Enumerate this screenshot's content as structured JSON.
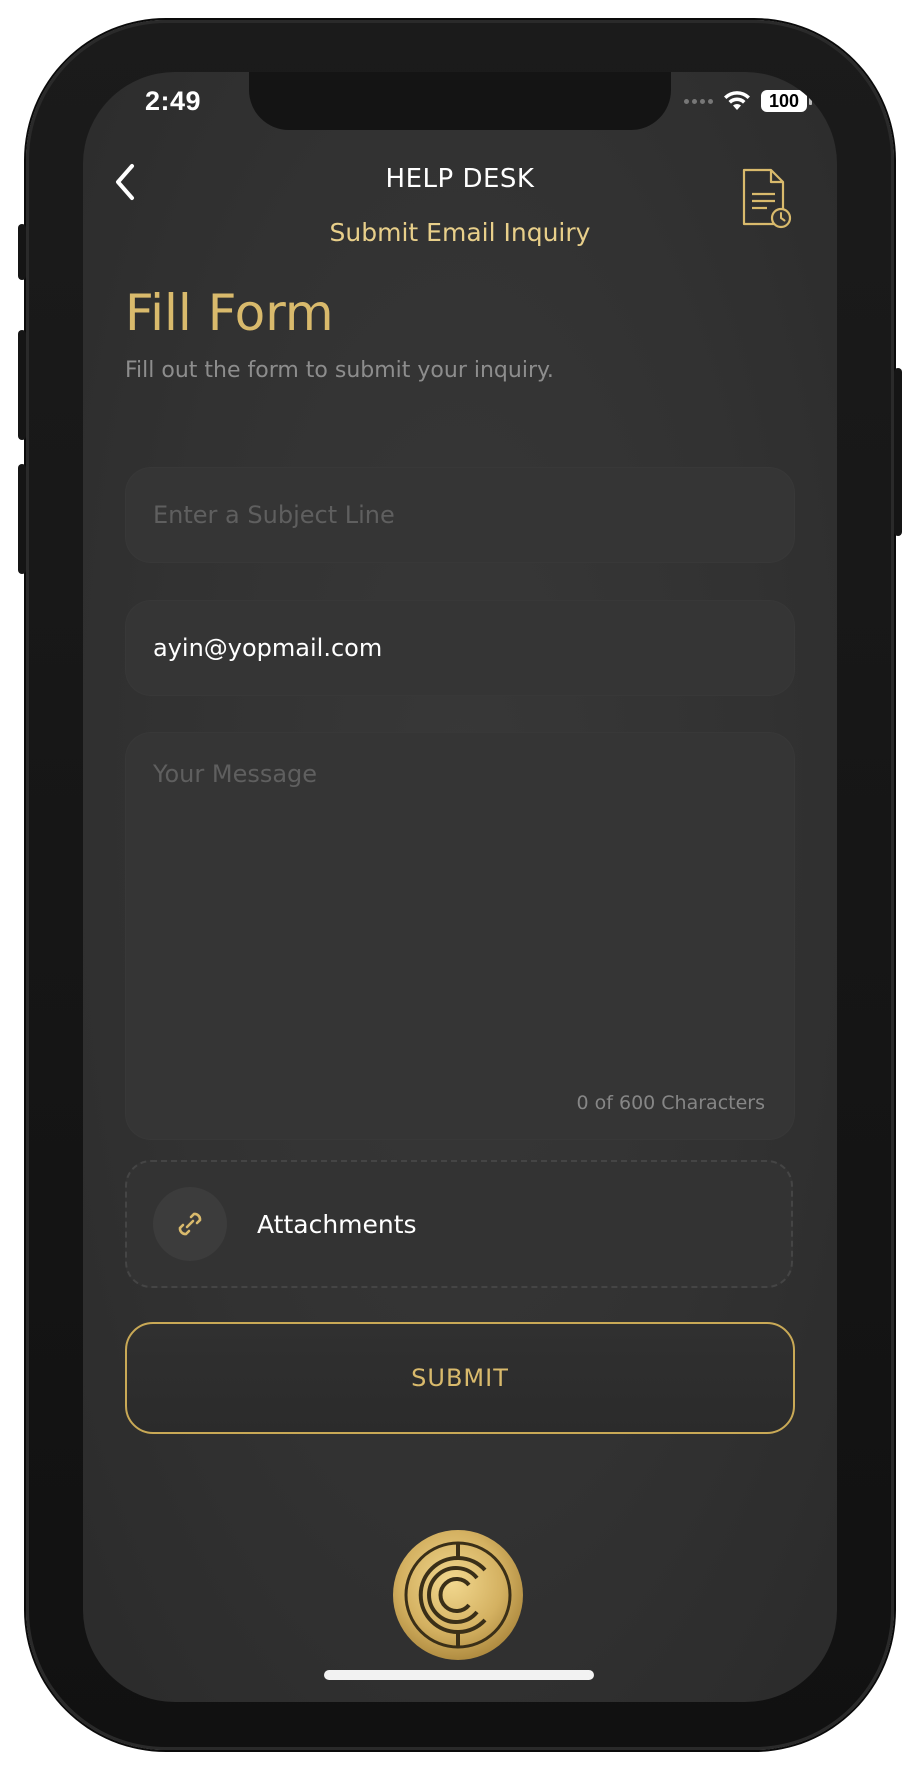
{
  "status_bar": {
    "time": "2:49",
    "battery": "100"
  },
  "header": {
    "title": "HELP DESK",
    "subtitle": "Submit Email Inquiry"
  },
  "form": {
    "title": "Fill Form",
    "description": "Fill out the form to submit your inquiry.",
    "subject_placeholder": "Enter a Subject Line",
    "subject_value": "",
    "email_value": "ayin@yopmail.com",
    "message_placeholder": "Your Message",
    "message_value": "",
    "char_count": "0 of 600 Characters",
    "attachments_label": "Attachments",
    "submit_label": "SUBMIT"
  },
  "icons": {
    "back": "chevron-left-icon",
    "history": "document-clock-icon",
    "attach": "link-icon",
    "logo": "brand-logo"
  },
  "colors": {
    "accent_gold": "#d9ba6c",
    "subtitle_gold": "#e8cf8a",
    "background": "#333333",
    "field_bg": "#353535"
  }
}
